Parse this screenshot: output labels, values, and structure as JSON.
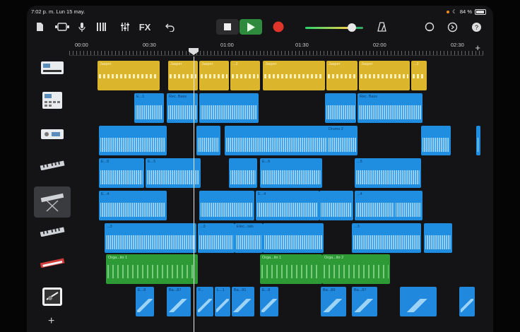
{
  "status_bar": {
    "time_date": "7:02 p. m.  Lun 15 may.",
    "battery": "84 %"
  },
  "toolbar": {
    "fx_label": "FX",
    "volume_level": 0.8,
    "accent_play": "#2e8b3e",
    "accent_record": "#e0352b"
  },
  "ruler": {
    "labels": [
      "00:00",
      "00:30",
      "01:00",
      "01:30",
      "02:00",
      "02:30"
    ]
  },
  "tracks": [
    {
      "icon": "keyboard-synth-icon",
      "regions": [
        {
          "name": "Jasper",
          "kind": "gold"
        },
        {
          "name": "Jasper",
          "kind": "gold"
        },
        {
          "name": "Jasper",
          "kind": "gold"
        },
        {
          "name": "...2",
          "kind": "gold"
        },
        {
          "name": "Jasper",
          "kind": "gold"
        },
        {
          "name": "Jasper",
          "kind": "gold"
        },
        {
          "name": "Jasper",
          "kind": "gold"
        },
        {
          "name": "...2",
          "kind": "gold"
        }
      ]
    },
    {
      "icon": "drum-machine-icon",
      "regions": [
        {
          "name": "E...1",
          "kind": "audio"
        },
        {
          "name": "Rec. Bass",
          "kind": "audio"
        },
        {
          "name": "",
          "kind": "audio"
        },
        {
          "name": "",
          "kind": "audio"
        },
        {
          "name": "Rec. Bass",
          "kind": "audio"
        }
      ]
    },
    {
      "icon": "audio-interface-icon",
      "regions": [
        {
          "name": "",
          "kind": "audio"
        },
        {
          "name": "",
          "kind": "audio"
        },
        {
          "name": "",
          "kind": "audio"
        },
        {
          "name": "Drums 2",
          "kind": "audio"
        },
        {
          "name": "",
          "kind": "audio"
        },
        {
          "name": "",
          "kind": "audio"
        }
      ]
    },
    {
      "icon": "keyboard-icon",
      "regions": [
        {
          "name": "E...5",
          "kind": "audio"
        },
        {
          "name": "E...5",
          "kind": "audio"
        },
        {
          "name": "",
          "kind": "audio"
        },
        {
          "name": "E...5",
          "kind": "audio"
        },
        {
          "name": "...5",
          "kind": "audio"
        }
      ]
    },
    {
      "icon": "piano-stand-icon",
      "regions": [
        {
          "name": "E...4",
          "kind": "audio"
        },
        {
          "name": "",
          "kind": "audio"
        },
        {
          "name": "E...4",
          "kind": "audio"
        },
        {
          "name": "",
          "kind": "audio"
        },
        {
          "name": "...4",
          "kind": "audio"
        },
        {
          "name": "",
          "kind": "audio"
        }
      ]
    },
    {
      "icon": "keyboard-icon",
      "regions": [
        {
          "name": "...3",
          "kind": "audio"
        },
        {
          "name": "...3",
          "kind": "audio"
        },
        {
          "name": "Elec...tals",
          "kind": "audio"
        },
        {
          "name": "",
          "kind": "audio"
        },
        {
          "name": "...3",
          "kind": "audio"
        },
        {
          "name": "",
          "kind": "audio"
        }
      ]
    },
    {
      "icon": "red-keyboard-icon",
      "regions": [
        {
          "name": "Orga...ito 1",
          "kind": "green"
        },
        {
          "name": "Orga...ito 1",
          "kind": "green"
        },
        {
          "name": "Orga...ito 2",
          "kind": "green"
        }
      ]
    },
    {
      "icon": "drummer-icon",
      "regions": [
        {
          "name": "E...8",
          "kind": "drum"
        },
        {
          "name": "Ba...87",
          "kind": "drum"
        },
        {
          "name": "F...",
          "kind": "drum"
        },
        {
          "name": "L...1",
          "kind": "drum"
        },
        {
          "name": "Ba...91",
          "kind": "drum"
        },
        {
          "name": "E...8",
          "kind": "drum"
        },
        {
          "name": "Ba...89",
          "kind": "drum"
        },
        {
          "name": "Ba...87",
          "kind": "drum"
        },
        {
          "name": "",
          "kind": "drum"
        },
        {
          "name": "",
          "kind": "drum"
        }
      ]
    }
  ]
}
